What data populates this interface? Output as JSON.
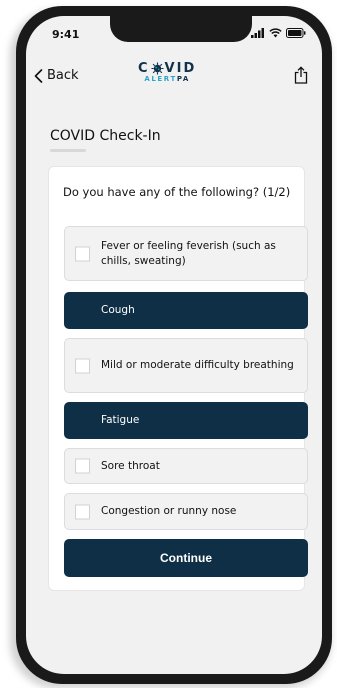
{
  "status_bar": {
    "time": "9:41"
  },
  "header": {
    "back_label": "Back",
    "logo_top_left": "C",
    "logo_top_right": "VID",
    "logo_bottom_alert": "ALERT",
    "logo_bottom_pa": "PA"
  },
  "page": {
    "title": "COVID Check-In"
  },
  "question": {
    "text": "Do you have any of the following? (1/2)"
  },
  "options": [
    {
      "label": "Fever or feeling feverish (such as chills, sweating)",
      "selected": false
    },
    {
      "label": "Cough",
      "selected": true
    },
    {
      "label": "Mild or moderate difficulty breathing",
      "selected": false
    },
    {
      "label": "Fatigue",
      "selected": true
    },
    {
      "label": "Sore throat",
      "selected": false
    },
    {
      "label": "Congestion or runny nose",
      "selected": false
    }
  ],
  "continue": {
    "label": "Continue"
  },
  "colors": {
    "primary": "#0e2f45",
    "accent": "#29a6c9",
    "background": "#f1f1f1"
  }
}
